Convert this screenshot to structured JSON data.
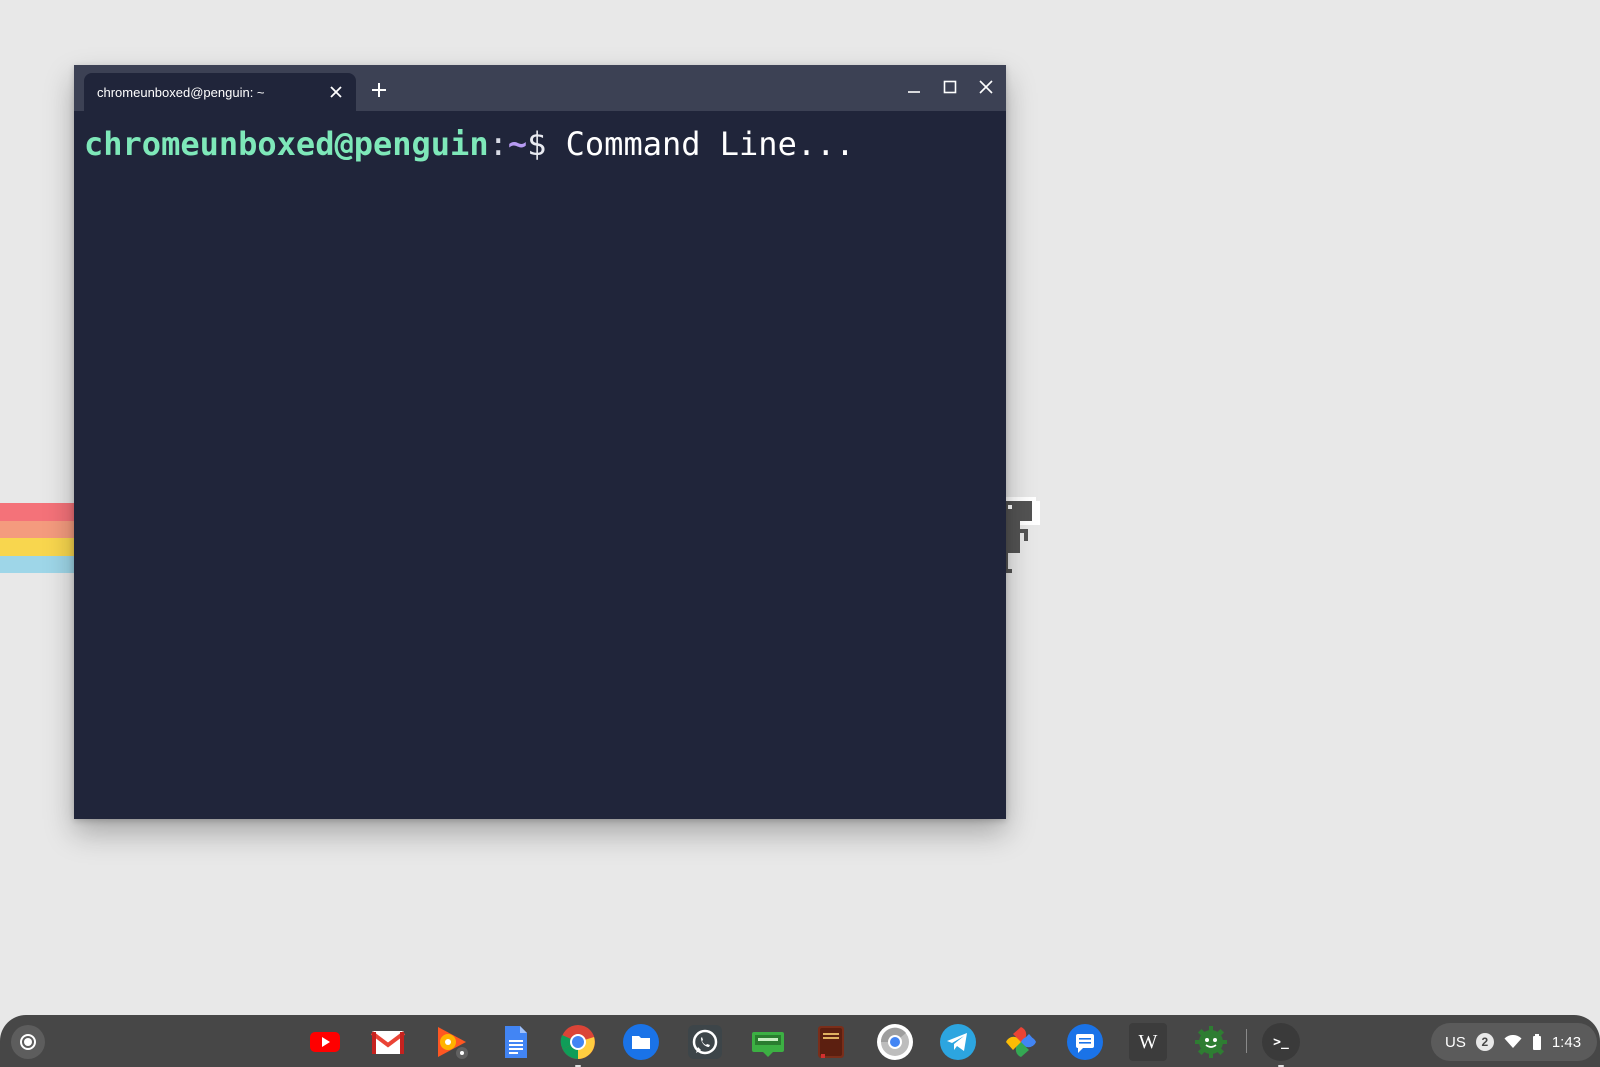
{
  "window": {
    "tab_title": "chromeunboxed@penguin: ~",
    "close_tab_label": "✕",
    "new_tab_label": "+"
  },
  "terminal": {
    "user_host": "chromeunboxed@penguin",
    "separator": ":",
    "path": "~",
    "prompt_symbol": "$",
    "command": " Command Line..."
  },
  "shelf": {
    "apps": [
      {
        "name": "YouTube",
        "icon": "youtube-icon",
        "color": "#ff0000"
      },
      {
        "name": "Gmail",
        "icon": "gmail-icon",
        "color": "#ea4335"
      },
      {
        "name": "Google Play Music",
        "icon": "play-music-icon",
        "color": "#ff5722"
      },
      {
        "name": "Google Docs",
        "icon": "docs-icon",
        "color": "#4285f4"
      },
      {
        "name": "Chrome",
        "icon": "chrome-icon",
        "color": "#4285f4"
      },
      {
        "name": "Files",
        "icon": "files-icon",
        "color": "#1a73e8"
      },
      {
        "name": "WhatsApp",
        "icon": "whatsapp-icon",
        "color": "#25d366"
      },
      {
        "name": "Shift Edit",
        "icon": "shiftedit-icon",
        "color": "#3cb043"
      },
      {
        "name": "Holy Bible",
        "icon": "bible-icon",
        "color": "#7a2e1a"
      },
      {
        "name": "Chrome Canary",
        "icon": "chrome-canary-icon",
        "color": "#9e9e9e"
      },
      {
        "name": "Telegram",
        "icon": "telegram-icon",
        "color": "#2ca5e0"
      },
      {
        "name": "Google Photos",
        "icon": "photos-icon",
        "color": "#fbbc05"
      },
      {
        "name": "Messages",
        "icon": "messages-icon",
        "color": "#1a73e8"
      },
      {
        "name": "Wikipedia",
        "icon": "wikipedia-icon",
        "color": "#3c3c3c"
      },
      {
        "name": "Settings Bug",
        "icon": "android-gear-icon",
        "color": "#2e7d32"
      }
    ],
    "terminal_app": {
      "label": ">_",
      "icon": "terminal-icon"
    },
    "w_label": "W"
  },
  "tray": {
    "keyboard_layout": "US",
    "notification_count": "2",
    "time": "1:43"
  },
  "colors": {
    "terminal_bg": "#20253a",
    "titlebar_bg": "#3c4154",
    "prompt_user": "#7ee8b9",
    "prompt_path": "#b79bf2",
    "shelf_bg": "#474747"
  }
}
